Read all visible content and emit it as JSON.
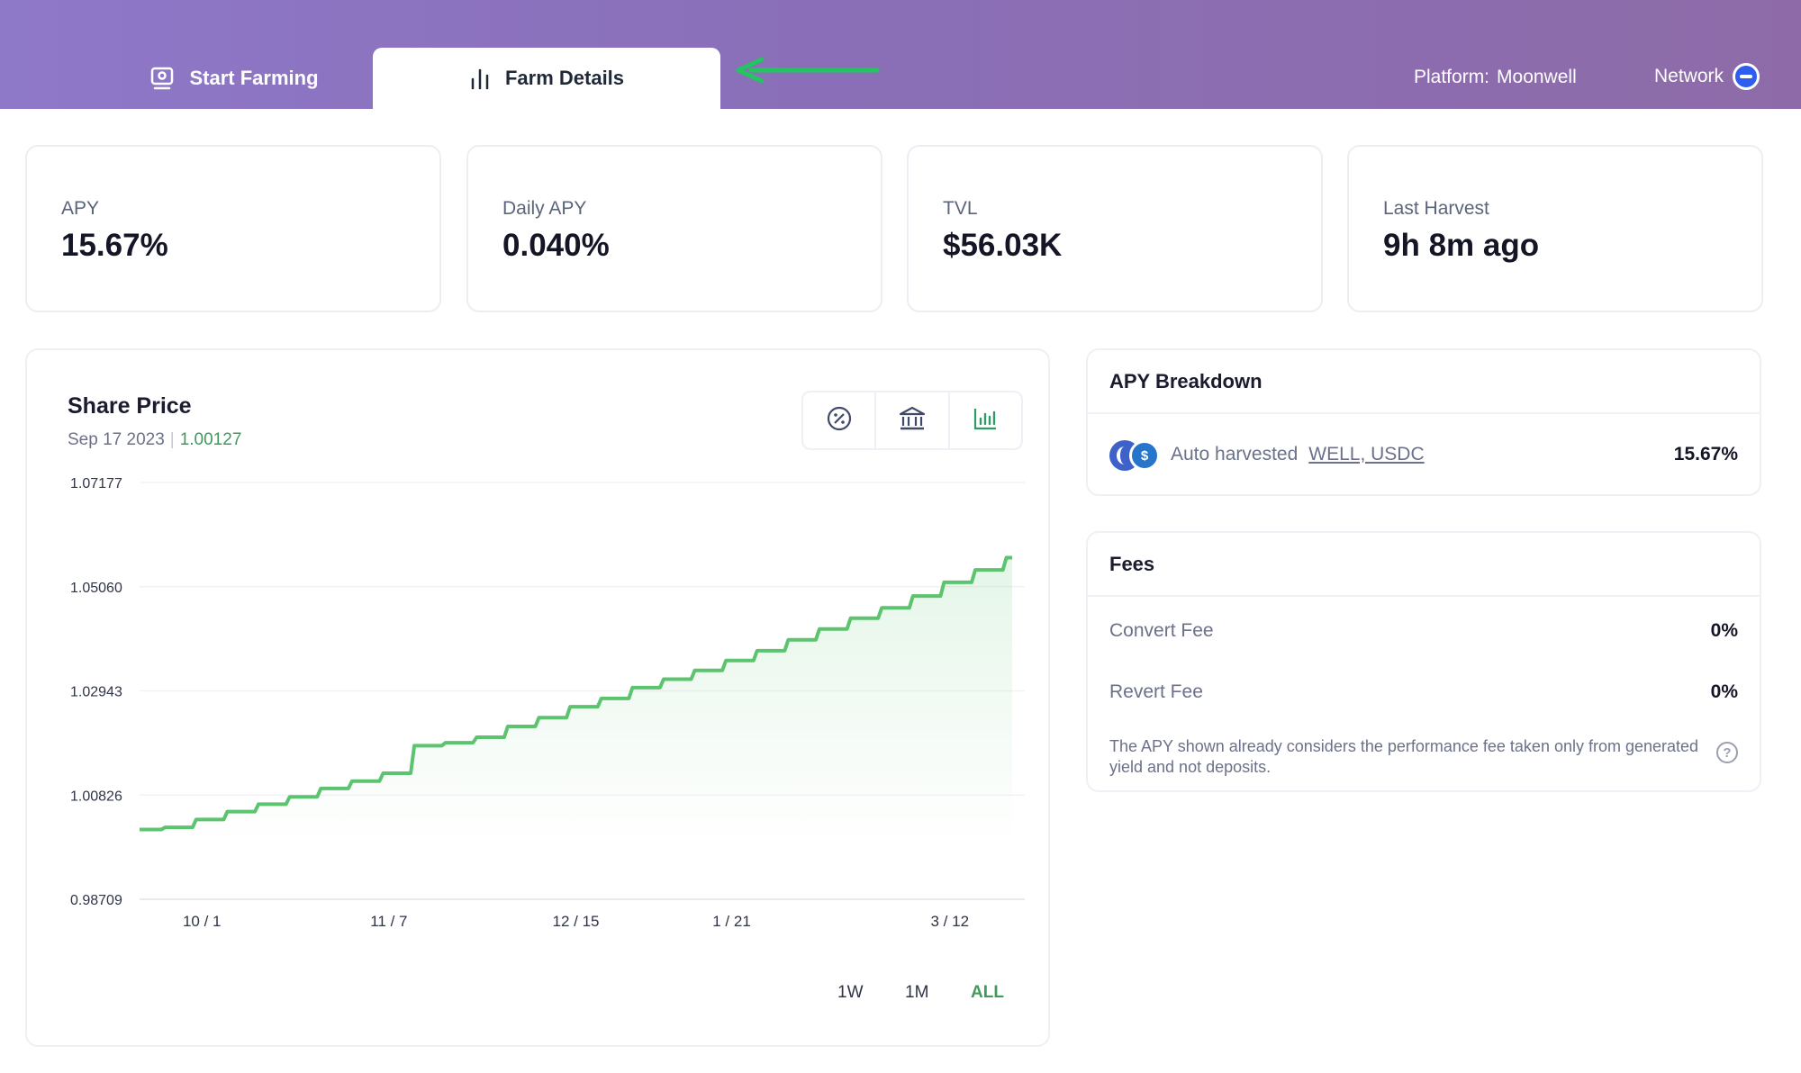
{
  "header": {
    "tabs": [
      {
        "label": "Start Farming",
        "icon": "farm-icon",
        "active": false
      },
      {
        "label": "Farm Details",
        "icon": "bar-chart-icon",
        "active": true
      }
    ],
    "platform_label": "Platform:",
    "platform_value": "Moonwell",
    "network_label": "Network",
    "annotation_arrow_color": "#22c55e"
  },
  "stats": [
    {
      "label": "APY",
      "value": "15.67%"
    },
    {
      "label": "Daily APY",
      "value": "0.040%"
    },
    {
      "label": "TVL",
      "value": "$56.03K"
    },
    {
      "label": "Last Harvest",
      "value": "9h 8m ago"
    }
  ],
  "share_price": {
    "title": "Share Price",
    "date": "Sep 17 2023",
    "separator": "|",
    "price": "1.00127",
    "ranges": [
      "1W",
      "1M",
      "ALL"
    ],
    "active_range": "ALL",
    "buttons": [
      "percent-icon",
      "bank-icon",
      "bar-chart-icon"
    ]
  },
  "chart_data": {
    "type": "area",
    "title": "Share Price",
    "x": [
      "9/17",
      "9/24",
      "10/1",
      "10/8",
      "10/15",
      "10/22",
      "10/29",
      "11/5",
      "11/7",
      "11/14",
      "11/21",
      "11/28",
      "12/5",
      "12/12",
      "12/15",
      "12/22",
      "12/29",
      "1/5",
      "1/12",
      "1/21",
      "1/28",
      "2/4",
      "2/11",
      "2/18",
      "2/25",
      "3/3",
      "3/12",
      "3/19",
      "3/26"
    ],
    "values": [
      1.00127,
      1.0017,
      1.0033,
      1.0049,
      1.0064,
      1.0079,
      1.0096,
      1.0111,
      1.0127,
      1.0183,
      1.0189,
      1.02,
      1.0222,
      1.024,
      1.0262,
      1.0279,
      1.0301,
      1.0318,
      1.0336,
      1.0356,
      1.0376,
      1.0398,
      1.042,
      1.0442,
      1.0463,
      1.0487,
      1.0515,
      1.054,
      1.0565
    ],
    "xticks": [
      "10 / 1",
      "11 / 7",
      "12 / 15",
      "1 / 21",
      "3 / 12"
    ],
    "yticks": [
      "1.07177",
      "1.05060",
      "1.02943",
      "1.00826",
      "0.98709"
    ],
    "ylim": [
      0.98709,
      1.07177
    ],
    "grid": true,
    "line_color": "#5cc46f"
  },
  "apy_breakdown": {
    "title": "APY Breakdown",
    "label": "Auto harvested",
    "tokens": "WELL, USDC",
    "value": "15.67%"
  },
  "fees": {
    "title": "Fees",
    "items": [
      {
        "label": "Convert Fee",
        "value": "0%"
      },
      {
        "label": "Revert Fee",
        "value": "0%"
      }
    ],
    "note": "The APY shown already considers the performance fee taken only from generated yield and not deposits."
  }
}
